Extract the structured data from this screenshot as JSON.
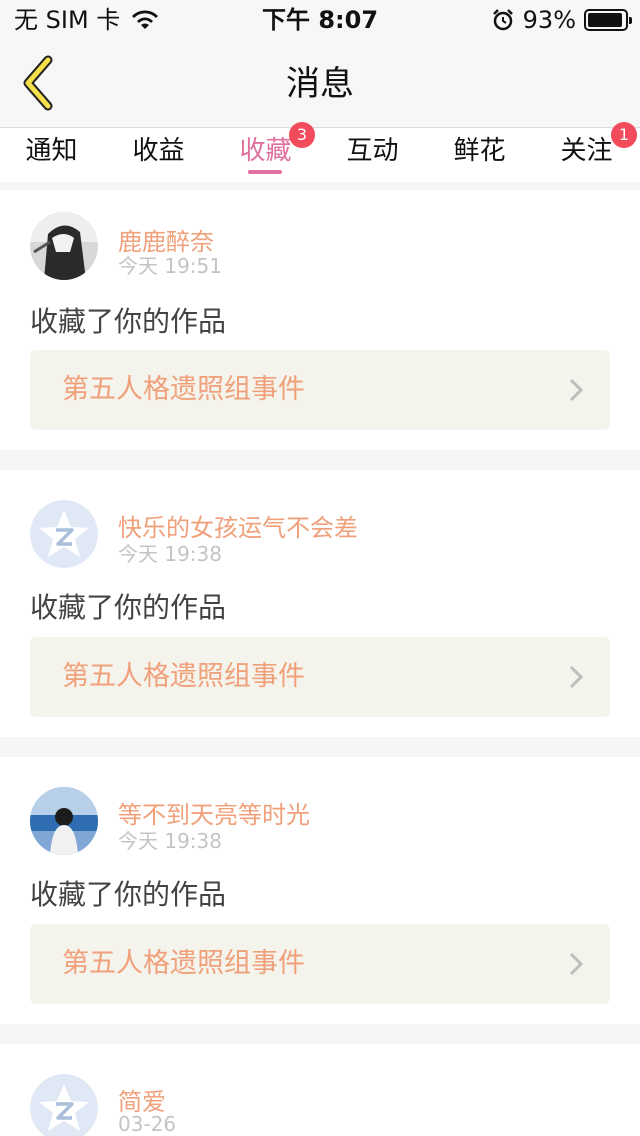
{
  "status_bar": {
    "carrier": "无 SIM 卡",
    "time": "下午 8:07",
    "battery": "93%"
  },
  "nav": {
    "title": "消息"
  },
  "tabs": [
    {
      "label": "通知",
      "badge": ""
    },
    {
      "label": "收益",
      "badge": ""
    },
    {
      "label": "收藏",
      "badge": "3",
      "active": true
    },
    {
      "label": "互动",
      "badge": ""
    },
    {
      "label": "鲜花",
      "badge": ""
    },
    {
      "label": "关注",
      "badge": "1"
    }
  ],
  "messages": [
    {
      "user": "鹿鹿醉奈",
      "time": "今天 19:51",
      "action": "收藏了你的作品",
      "work": "第五人格遗照组事件",
      "avatar": "photo-dark"
    },
    {
      "user": "快乐的女孩运气不会差",
      "time": "今天 19:38",
      "action": "收藏了你的作品",
      "work": "第五人格遗照组事件",
      "avatar": "default-star"
    },
    {
      "user": "等不到天亮等时光",
      "time": "今天 19:38",
      "action": "收藏了你的作品",
      "work": "第五人格遗照组事件",
      "avatar": "photo-sea"
    },
    {
      "user": "简爱",
      "time": "03-26",
      "action": "",
      "work": "",
      "avatar": "default-star"
    }
  ],
  "colors": {
    "accent": "#e0709e",
    "name": "#f0a07a",
    "badge": "#f24b5b",
    "back_icon": "#f5e04a"
  }
}
